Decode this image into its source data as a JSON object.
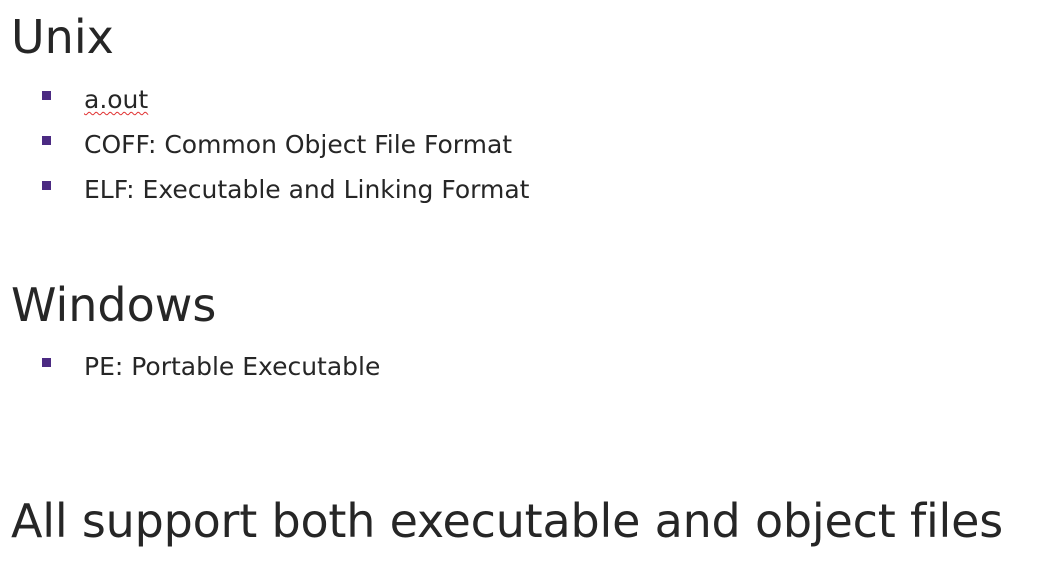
{
  "sections": [
    {
      "heading": "Unix",
      "items": [
        "a.out",
        "COFF: Common Object File Format",
        "ELF: Executable and Linking Format"
      ]
    },
    {
      "heading": "Windows",
      "items": [
        "PE: Portable Executable"
      ]
    }
  ],
  "summary": "All support both executable and object files",
  "colors": {
    "text": "#262626",
    "bullet": "#4b2a82",
    "spellcheck_underline": "#e03030"
  }
}
